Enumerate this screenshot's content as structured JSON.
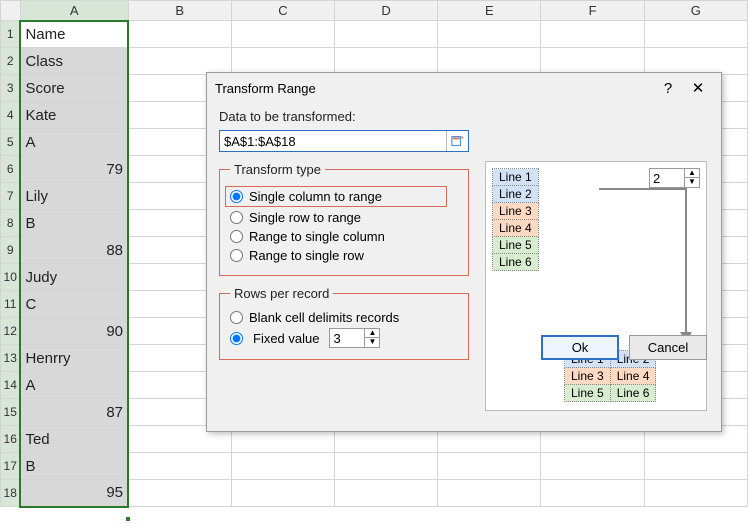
{
  "sheet": {
    "columns": [
      "A",
      "B",
      "C",
      "D",
      "E",
      "F",
      "G"
    ],
    "rows": [
      {
        "n": "1",
        "a": "Name",
        "type": "text"
      },
      {
        "n": "2",
        "a": "Class",
        "type": "text"
      },
      {
        "n": "3",
        "a": "Score",
        "type": "text"
      },
      {
        "n": "4",
        "a": "Kate",
        "type": "text"
      },
      {
        "n": "5",
        "a": "A",
        "type": "text"
      },
      {
        "n": "6",
        "a": "79",
        "type": "num"
      },
      {
        "n": "7",
        "a": "Lily",
        "type": "text"
      },
      {
        "n": "8",
        "a": "B",
        "type": "text"
      },
      {
        "n": "9",
        "a": "88",
        "type": "num"
      },
      {
        "n": "10",
        "a": "Judy",
        "type": "text"
      },
      {
        "n": "11",
        "a": "C",
        "type": "text"
      },
      {
        "n": "12",
        "a": "90",
        "type": "num"
      },
      {
        "n": "13",
        "a": "Henrry",
        "type": "text"
      },
      {
        "n": "14",
        "a": "A",
        "type": "text"
      },
      {
        "n": "15",
        "a": "87",
        "type": "num"
      },
      {
        "n": "16",
        "a": "Ted",
        "type": "text"
      },
      {
        "n": "17",
        "a": "B",
        "type": "text"
      },
      {
        "n": "18",
        "a": "95",
        "type": "num"
      }
    ]
  },
  "dialog": {
    "title": "Transform Range",
    "help_label": "?",
    "close_label": "✕",
    "data_label": "Data to be transformed:",
    "ref_value": "$A$1:$A$18",
    "transform": {
      "legend": "Transform type",
      "opt1": "Single column to range",
      "opt2": "Single row to range",
      "opt3": "Range to single column",
      "opt4": "Range to single row"
    },
    "rows": {
      "legend": "Rows per record",
      "opt1": "Blank cell delimits records",
      "opt2": "Fixed value",
      "fixed_value": "3"
    },
    "preview": {
      "spin_value": "2",
      "lines": {
        "l1": "Line 1",
        "l2": "Line 2",
        "l3": "Line 3",
        "l4": "Line 4",
        "l5": "Line 5",
        "l6": "Line 6"
      }
    },
    "ok": "Ok",
    "cancel": "Cancel"
  }
}
